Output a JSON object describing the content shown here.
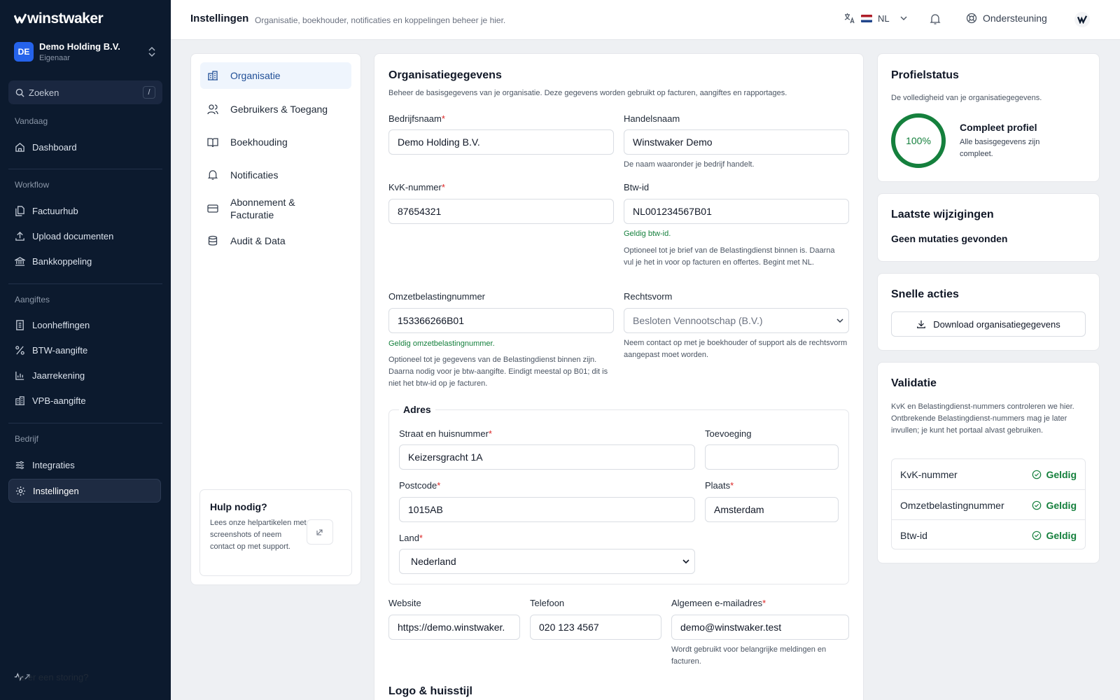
{
  "app": {
    "brand": "winstwaker"
  },
  "org": {
    "initials": "DE",
    "name": "Demo Holding B.V.",
    "role": "Eigenaar"
  },
  "sidebar": {
    "search_placeholder": "Zoeken",
    "search_shortcut": "/",
    "sections": [
      {
        "title": "Vandaag",
        "items": [
          {
            "label": "Dashboard"
          }
        ]
      },
      {
        "title": "Workflow",
        "items": [
          {
            "label": "Factuurhub"
          },
          {
            "label": "Upload documenten"
          },
          {
            "label": "Bankkoppeling"
          }
        ]
      },
      {
        "title": "Aangiftes",
        "items": [
          {
            "label": "Loonheffingen"
          },
          {
            "label": "BTW-aangifte"
          },
          {
            "label": "Jaarrekening"
          },
          {
            "label": "VPB-aangifte"
          }
        ]
      },
      {
        "title": "Bedrijf",
        "items": [
          {
            "label": "Integraties"
          },
          {
            "label": "Instellingen"
          }
        ]
      }
    ],
    "footer_label": "Is er een storing?"
  },
  "topbar": {
    "title": "Instellingen",
    "subtitle": "Organisatie, boekhouder, notificaties en koppelingen beheer je hier.",
    "language": "NL",
    "support_label": "Ondersteuning"
  },
  "settings_nav": {
    "items": [
      {
        "label": "Organisatie"
      },
      {
        "label": "Gebruikers & Toegang"
      },
      {
        "label": "Boekhouding"
      },
      {
        "label": "Notificaties"
      },
      {
        "label": "Abonnement &",
        "label2": "Facturatie"
      },
      {
        "label": "Audit & Data"
      }
    ],
    "help": {
      "title": "Hulp nodig?",
      "description": "Lees onze helpartikelen met screenshots of neem contact op met support."
    }
  },
  "form": {
    "title": "Organisatiegegevens",
    "description": "Beheer de basisgegevens van je organisatie. Deze gegevens worden gebruikt op facturen, aangiftes en rapportages.",
    "bedrijfsnaam": {
      "label": "Bedrijfsnaam",
      "value": "Demo Holding B.V."
    },
    "handelsnaam": {
      "label": "Handelsnaam",
      "value": "Winstwaker Demo",
      "help": "De naam waaronder je bedrijf handelt."
    },
    "kvk": {
      "label": "KvK-nummer",
      "value": "87654321"
    },
    "btw": {
      "label": "Btw-id",
      "value": "NL001234567B01",
      "valid": "Geldig btw-id.",
      "help": "Optioneel tot je brief van de Belastingdienst binnen is. Daarna vul je het in voor op facturen en offertes. Begint met NL."
    },
    "omzet": {
      "label": "Omzetbelastingnummer",
      "value": "153366266B01",
      "valid": "Geldig omzetbelastingnummer.",
      "help": "Optioneel tot je gegevens van de Belastingdienst binnen zijn. Daarna nodig voor je btw-aangifte. Eindigt meestal op B01; dit is niet het btw-id op je facturen."
    },
    "rechtsvorm": {
      "label": "Rechtsvorm",
      "value": "Besloten Vennootschap (B.V.)",
      "help": "Neem contact op met je boekhouder of support als de rechtsvorm aangepast moet worden."
    },
    "adres": {
      "legend": "Adres",
      "straat": {
        "label": "Straat en huisnummer",
        "value": "Keizersgracht 1A"
      },
      "toevoeging": {
        "label": "Toevoeging",
        "value": ""
      },
      "postcode": {
        "label": "Postcode",
        "value": "1015AB"
      },
      "plaats": {
        "label": "Plaats",
        "value": "Amsterdam"
      },
      "land": {
        "label": "Land",
        "value": "Nederland"
      }
    },
    "website": {
      "label": "Website",
      "value": "https://demo.winstwaker."
    },
    "telefoon": {
      "label": "Telefoon",
      "value": "020 123 4567"
    },
    "email": {
      "label": "Algemeen e-mailadres",
      "value": "demo@winstwaker.test",
      "help": "Wordt gebruikt voor belangrijke meldingen en facturen."
    },
    "logo_title": "Logo & huisstijl"
  },
  "profile": {
    "title": "Profielstatus",
    "description": "De volledigheid van je organisatiegegevens.",
    "percent": "100%",
    "status_title": "Compleet profiel",
    "status_text": "Alle basisgegevens zijn compleet."
  },
  "changes": {
    "title": "Laatste wijzigingen",
    "empty": "Geen mutaties gevonden"
  },
  "quick": {
    "title": "Snelle acties",
    "download_label": "Download organisatiegegevens"
  },
  "validation": {
    "title": "Validatie",
    "description": "KvK en Belastingdienst-nummers controleren we hier. Ontbrekende Belastingdienst-nummers mag je later invullen; je kunt het portaal alvast gebruiken.",
    "rows": [
      {
        "name": "KvK-nummer",
        "status": "Geldig"
      },
      {
        "name": "Omzetbelastingnummer",
        "status": "Geldig"
      },
      {
        "name": "Btw-id",
        "status": "Geldig"
      }
    ]
  },
  "colors": {
    "sidebar_bg": "#0c1a2e",
    "accent": "#2563eb",
    "success": "#15803d",
    "required": "#dc2626"
  }
}
